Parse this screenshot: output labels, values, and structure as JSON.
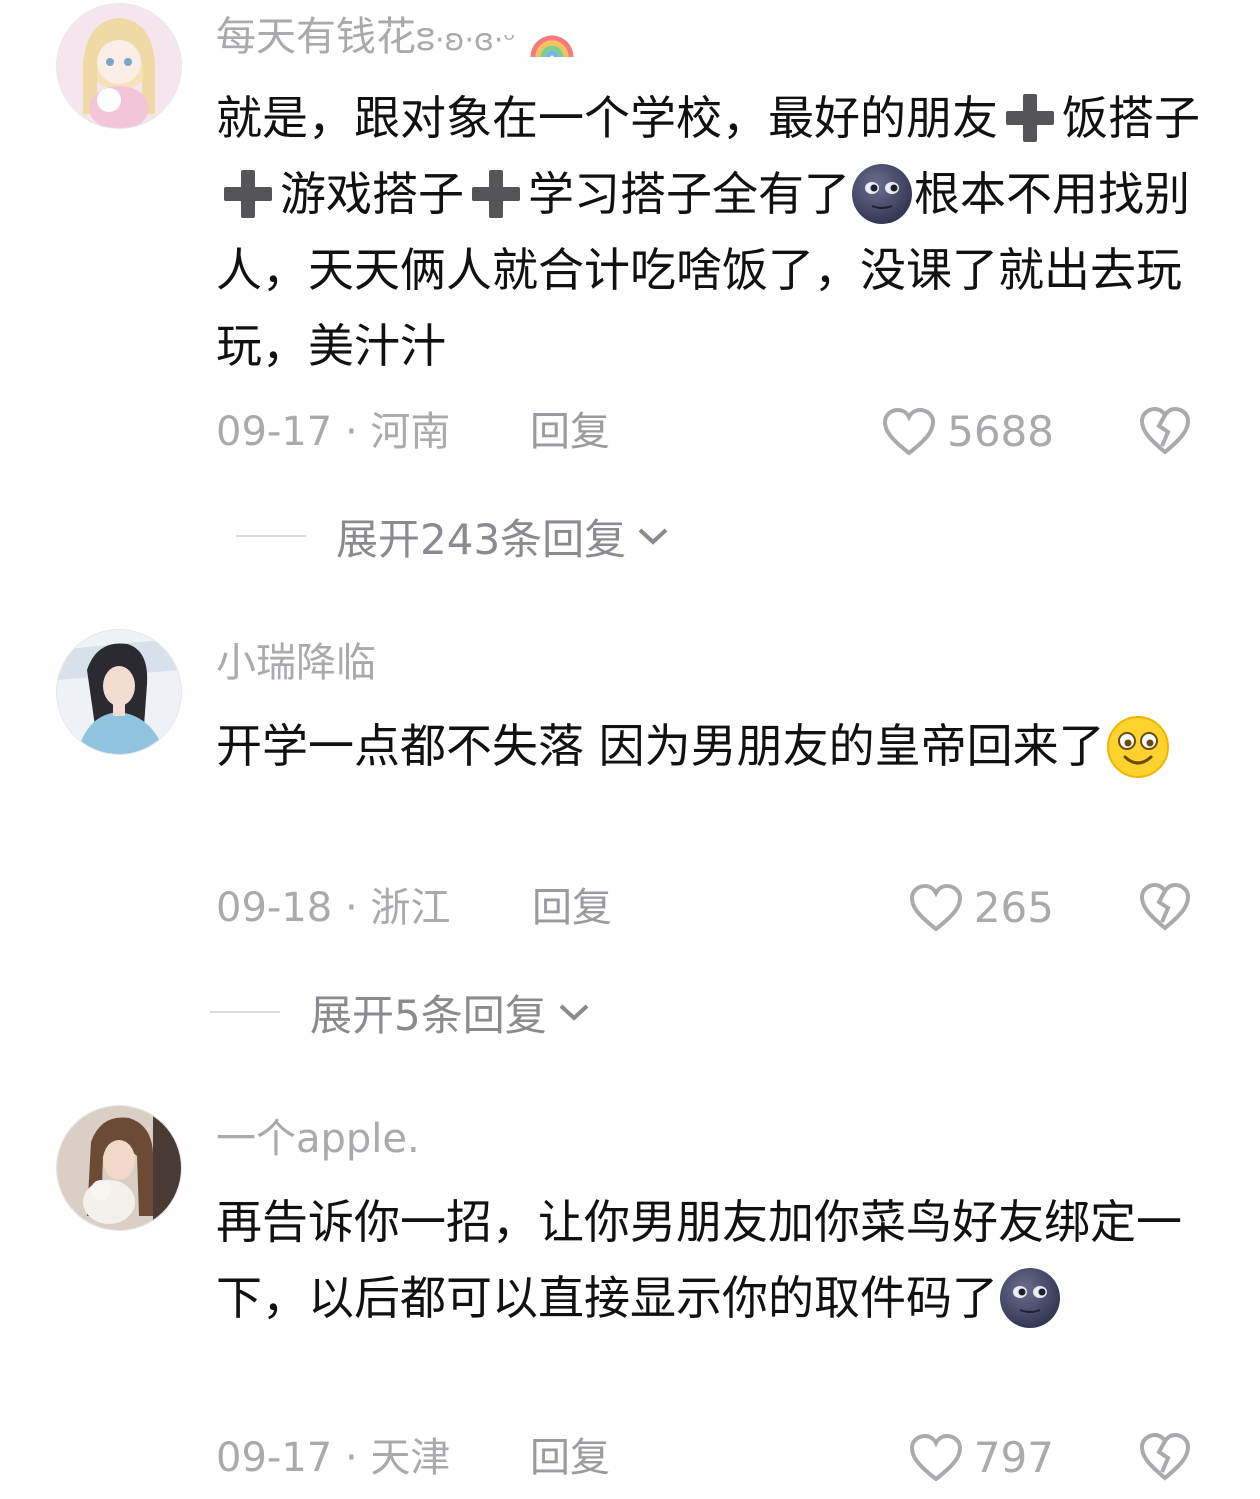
{
  "comments": [
    {
      "username": "每天有钱花",
      "username_suffix": "ⵓ·ʚ·ɞ·ᵕ",
      "body": [
        {
          "t": "text",
          "v": "就是，跟对象在一个学校，最好的朋友"
        },
        {
          "t": "emoji",
          "icon": "heavy-plus-emoji"
        },
        {
          "t": "text",
          "v": "饭搭子"
        },
        {
          "t": "emoji",
          "icon": "heavy-plus-emoji"
        },
        {
          "t": "text",
          "v": "游戏搭子"
        },
        {
          "t": "emoji",
          "icon": "heavy-plus-emoji"
        },
        {
          "t": "text",
          "v": "学习搭子全有了"
        },
        {
          "t": "emoji",
          "icon": "new-moon-face-emoji"
        },
        {
          "t": "text",
          "v": "根本不用找别人，天天俩人就合计吃啥饭了，没课了就出去玩玩，美汁汁"
        }
      ],
      "date": "09-17",
      "location": "河南",
      "reply_label": "回复",
      "likes": "5688",
      "expand_label": "展开243条回复"
    },
    {
      "username": "小瑞降临",
      "body": [
        {
          "t": "text",
          "v": "开学一点都不失落 因为男朋友的皇帝回来了"
        },
        {
          "t": "emoji",
          "icon": "smiling-face-emoji"
        }
      ],
      "date": "09-18",
      "location": "浙江",
      "reply_label": "回复",
      "likes": "265",
      "expand_label": "展开5条回复"
    },
    {
      "username": "一个apple.",
      "body": [
        {
          "t": "text",
          "v": "再告诉你一招，让你男朋友加你菜鸟好友绑定一下，以后都可以直接显示你的取件码了"
        },
        {
          "t": "emoji",
          "icon": "new-moon-face-emoji"
        }
      ],
      "date": "09-17",
      "location": "天津",
      "reply_label": "回复",
      "likes": "797"
    }
  ],
  "separator": " · ",
  "colors": {
    "text_primary": "#111111",
    "text_secondary": "#a9a9ae",
    "background": "#ffffff"
  }
}
